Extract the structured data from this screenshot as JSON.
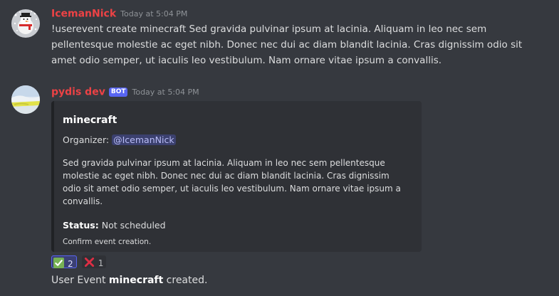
{
  "messages": [
    {
      "username": "IcemanNick",
      "timestamp": "Today at 5:04 PM",
      "text": "!userevent create minecraft Sed gravida pulvinar ipsum at lacinia. Aliquam in leo nec sem pellentesque molestie ac eget nibh. Donec nec dui ac diam blandit lacinia. Cras dignissim odio sit amet odio semper, ut iaculis leo vestibulum. Nam ornare vitae ipsum a convallis.",
      "avatar_icon": "snowman-avatar-icon"
    },
    {
      "username": "pydis dev",
      "bot_tag": "BOT",
      "timestamp": "Today at 5:04 PM",
      "avatar_icon": "landscape-avatar-icon",
      "embed": {
        "title": "minecraft",
        "organizer_label": "Organizer:",
        "organizer_mention": "@IcemanNick",
        "description": "Sed gravida pulvinar ipsum at lacinia. Aliquam in leo nec sem pellentesque molestie ac eget nibh. Donec nec dui ac diam blandit lacinia. Cras dignissim odio sit amet odio semper, ut iaculis leo vestibulum. Nam ornare vitae ipsum a convallis.",
        "status_label": "Status:",
        "status_value": "Not scheduled",
        "footer": "Confirm event creation."
      },
      "reactions": [
        {
          "emoji": "check-mark-icon",
          "count": "2",
          "active": true
        },
        {
          "emoji": "cross-mark-icon",
          "count": "1",
          "active": false
        }
      ],
      "followup": {
        "prefix": "User Event",
        "name": "minecraft",
        "suffix": "created."
      }
    }
  ],
  "colors": {
    "background": "#36393f",
    "username": "#ed4245",
    "embed_background": "#2f3136",
    "bot_tag": "#5865f2",
    "mention": "#b9bcf6"
  }
}
